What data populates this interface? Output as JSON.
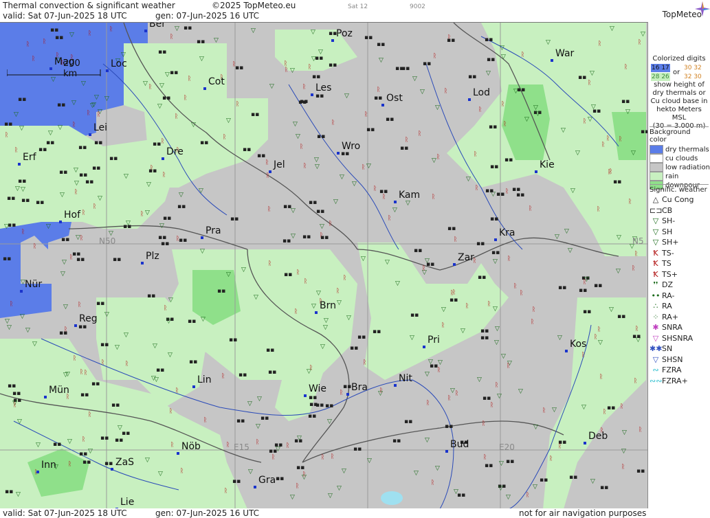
{
  "header": {
    "title": "Thermal convection & significant weather",
    "copyright": "©2025 TopMeteo.eu",
    "valid": "valid:  Sat   07-Jun-2025   18 UTC",
    "generated": "gen: 07-Jun-2025 16 UTC",
    "sat": "Sat 12",
    "code": "9002",
    "brand": "TopMeteo"
  },
  "map": {
    "scale_label": "200 km",
    "grid_labels": [
      "N50",
      "N5",
      "E15",
      "E20"
    ],
    "cities": [
      {
        "name": "Ber"
      },
      {
        "name": "Poz"
      },
      {
        "name": "War"
      },
      {
        "name": "Mag"
      },
      {
        "name": "Loc"
      },
      {
        "name": "Cot"
      },
      {
        "name": "Les"
      },
      {
        "name": "Lod"
      },
      {
        "name": "Ost"
      },
      {
        "name": "Lei"
      },
      {
        "name": "Erf"
      },
      {
        "name": "Dre"
      },
      {
        "name": "Wro"
      },
      {
        "name": "Jel"
      },
      {
        "name": "Kie"
      },
      {
        "name": "Kam"
      },
      {
        "name": "Hof"
      },
      {
        "name": "Pra"
      },
      {
        "name": "Kra"
      },
      {
        "name": "Plz"
      },
      {
        "name": "Zar"
      },
      {
        "name": "Nür"
      },
      {
        "name": "Brn"
      },
      {
        "name": "Reg"
      },
      {
        "name": "Pri"
      },
      {
        "name": "Kos"
      },
      {
        "name": "Lin"
      },
      {
        "name": "Nit"
      },
      {
        "name": "Wie"
      },
      {
        "name": "Bra"
      },
      {
        "name": "Mün"
      },
      {
        "name": "Deb"
      },
      {
        "name": "Nöb"
      },
      {
        "name": "Bud"
      },
      {
        "name": "ZaS"
      },
      {
        "name": "Inn"
      },
      {
        "name": "Gra"
      },
      {
        "name": "Lie"
      }
    ]
  },
  "legend": {
    "colorized_title": "Colorized digits",
    "digits_a": "16 17",
    "digits_b": "28 26",
    "or": "or",
    "digits_c": "30 32",
    "digits_d": "32 30",
    "desc": "show height of dry thermals or Cu cloud base in hekto Meters MSL",
    "desc_example": "(30 = 3.000 m)",
    "bg_title": "Background color",
    "bg_items": [
      {
        "label": "dry thermals",
        "color": "#5b7de8"
      },
      {
        "label": "cu clouds",
        "color": "#ffffff"
      },
      {
        "label": "low radiation",
        "color": "#c6c6c6"
      },
      {
        "label": "rain",
        "color": "#c8f0c0"
      },
      {
        "label": "downpour",
        "color": "#8fe08a"
      }
    ],
    "wx_title": "Signific. weather",
    "wx_items": [
      {
        "label": "Cu Cong",
        "sym": "△"
      },
      {
        "label": "CB",
        "sym": "⊏⊐"
      },
      {
        "label": "SH-",
        "sym": "▽"
      },
      {
        "label": "SH",
        "sym": "▽"
      },
      {
        "label": "SH+",
        "sym": "▽"
      },
      {
        "label": "TS-",
        "sym": "Ꝁ"
      },
      {
        "label": "TS",
        "sym": "Ꝁ"
      },
      {
        "label": "TS+",
        "sym": "Ꝁ"
      },
      {
        "label": "DZ",
        "sym": "❜❜"
      },
      {
        "label": "RA-",
        "sym": "••"
      },
      {
        "label": "RA",
        "sym": "∴"
      },
      {
        "label": "RA+",
        "sym": "⁘"
      },
      {
        "label": "SNRA",
        "sym": "✱"
      },
      {
        "label": "SHSNRA",
        "sym": "▽"
      },
      {
        "label": "SN",
        "sym": "✱✱"
      },
      {
        "label": "SHSN",
        "sym": "▽"
      },
      {
        "label": "FZRA",
        "sym": "∾"
      },
      {
        "label": "FZRA+",
        "sym": "∾∾"
      }
    ]
  },
  "footer": {
    "valid": "valid:  Sat   07-Jun-2025   18 UTC",
    "generated": "gen: 07-Jun-2025 16 UTC",
    "note": "not for air navigation purposes"
  }
}
